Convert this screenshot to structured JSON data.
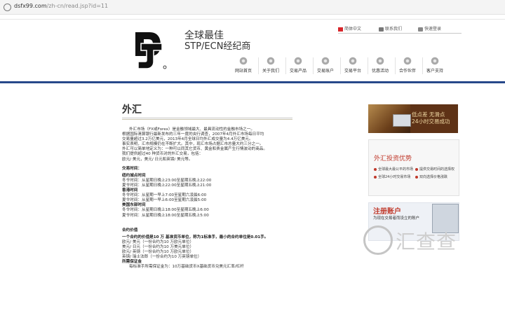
{
  "browser": {
    "domain": "dsfx99.com",
    "path": "/zh-cn/read.jsp?id=11"
  },
  "header": {
    "slogan_line1": "全球最佳",
    "slogan_line2": "STP/ECN经纪商",
    "top_links": [
      {
        "label": "简体中文",
        "icon": "china-flag-icon"
      },
      {
        "label": "联系我们",
        "icon": "phone-icon"
      },
      {
        "label": "快速登录",
        "icon": "login-icon"
      }
    ]
  },
  "nav": [
    {
      "label": "网站首页"
    },
    {
      "label": "关于我们"
    },
    {
      "label": "交易产品"
    },
    {
      "label": "交易账户"
    },
    {
      "label": "交易平台"
    },
    {
      "label": "优惠活动"
    },
    {
      "label": "合作伙伴"
    },
    {
      "label": "客户支持"
    }
  ],
  "article": {
    "title": "外汇",
    "paragraphs": [
      "外汇市场（FX或Forex）是金融领域最大、最具流动性的金融市场之一。",
      "根据国际清算银行最新发布的三年一度的央行调查，2007年4月外汇市场每日平均",
      "交易量超过3.2万亿美元，2013年4月全球日均外汇成交量为4.4万亿美元。",
      "事实表明，汇市规模仍在不断扩大。其中，现汇市场占据汇市总量大约三分之一。",
      "外汇可以简单地定义为：一种可以同其它货币、黄金和贵金属产生行情波动的商品。",
      "我们提供超过40 种货币对的外汇交易，包括：",
      "欧元/ 美元，美元/ 日元和英镑/ 美元等。"
    ],
    "trading_time_title": "交易时间：",
    "trading_sections": [
      {
        "name": "纽约城点时间",
        "lines": [
          "冬令时间：从星期日晚上23:00至星期五晚上22:00",
          "夏令时间：从星期日晚上22:00至星期五晚上21:00"
        ]
      },
      {
        "name": "香港时间",
        "lines": [
          "冬令时间：从星期一早上7:00至星期六凌晨6:00",
          "夏令时间：从星期一早上6:00至星期六凌晨5:00"
        ]
      },
      {
        "name": "美国东部时间",
        "lines": [
          "冬令时间：从星期日晚上18:00至星期五晚上6:00",
          "夏令时间：从星期日晚上18:00至星期五晚上5:00"
        ]
      }
    ],
    "contract_title": "合约价值",
    "contract_intro": "一个合约的价值是10 万 基准货币单位，称为1标准手，最小的合约单位是0.01手。",
    "contract_lines": [
      "欧元/ 美元（一份合约为10 万欧元单位）",
      "美元/ 日元（一份合约为10 万美元单位）",
      "欧元/ 英镑（一份合约为10 万欧元单位）",
      "英镑/ 瑞士法郎（一份合约为10 万英镑单位）"
    ],
    "margin_title": "所需保证金",
    "margin_line": "每标准手所需保证金为：10万基础货币X基础货币兑美元汇率/杠杆"
  },
  "sidebar": {
    "ad1_line1": "低点差  无滑点",
    "ad1_line2": "24小时交易成功",
    "ad2_title": "外汇投资优势",
    "ad2_features": [
      "全球最大最公平的市场",
      "提供交易时间的选择权",
      "全球24小时交易市场",
      "双向选择价格涨跌"
    ],
    "ad3_title": "注册账户",
    "ad3_subtitle": "为现在交易者而设立的账户"
  },
  "watermark": {
    "text": "汇查查"
  },
  "colors": {
    "nav_bar": "#27488a",
    "accent_red": "#c0392b"
  }
}
